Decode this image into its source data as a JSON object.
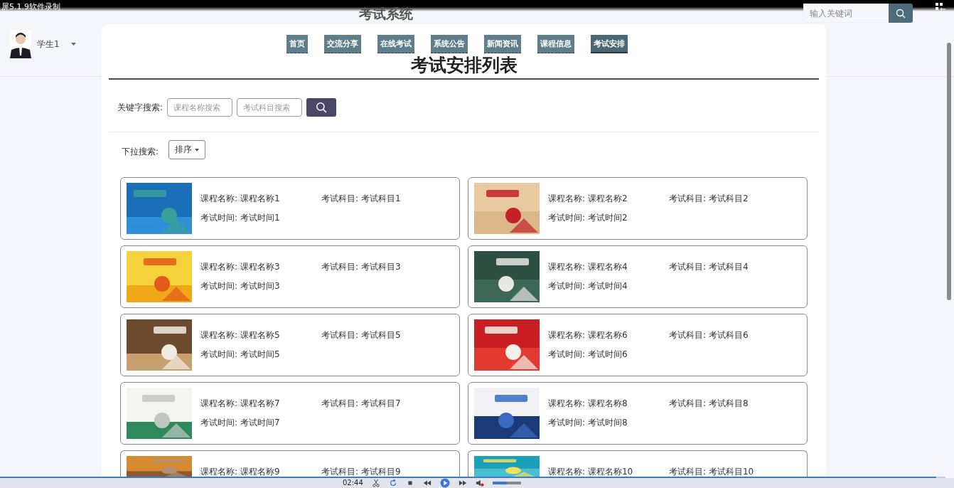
{
  "recorder": {
    "title": "屏5.1.9软件录制",
    "time": "02:44",
    "progress": {
      "level": 0.99
    },
    "volume": {
      "level": 0.5
    }
  },
  "header": {
    "site_title": "考试系统",
    "user": {
      "name": "学生1"
    },
    "search": {
      "placeholder": "输入关键词"
    }
  },
  "nav": [
    {
      "label": "首页",
      "selected": false
    },
    {
      "label": "交流分享",
      "selected": false
    },
    {
      "label": "在线考试",
      "selected": false
    },
    {
      "label": "系统公告",
      "selected": false
    },
    {
      "label": "新闻资讯",
      "selected": false
    },
    {
      "label": "课程信息",
      "selected": false
    },
    {
      "label": "考试安排",
      "selected": true
    }
  ],
  "page_title": "考试安排列表",
  "keyword_search": {
    "label": "关键字搜索:",
    "fields": [
      {
        "placeholder": "课程名称搜索"
      },
      {
        "placeholder": "考试科目搜索"
      }
    ]
  },
  "dropdown_search": {
    "label": "下拉搜索:",
    "button": "排序"
  },
  "cards": [
    {
      "name_label": "课程名称:",
      "name": "课程名称1",
      "subject_label": "考试科目:",
      "subject": "考试科目1",
      "time_label": "考试时间:",
      "time": "考试时间1"
    },
    {
      "name_label": "课程名称:",
      "name": "课程名称2",
      "subject_label": "考试科目:",
      "subject": "考试科目2",
      "time_label": "考试时间:",
      "time": "考试时间2"
    },
    {
      "name_label": "课程名称:",
      "name": "课程名称3",
      "subject_label": "考试科目:",
      "subject": "考试科目3",
      "time_label": "考试时间:",
      "time": "考试时间3"
    },
    {
      "name_label": "课程名称:",
      "name": "课程名称4",
      "subject_label": "考试科目:",
      "subject": "考试科目4",
      "time_label": "考试时间:",
      "time": "考试时间4"
    },
    {
      "name_label": "课程名称:",
      "name": "课程名称5",
      "subject_label": "考试科目:",
      "subject": "考试科目5",
      "time_label": "考试时间:",
      "time": "考试时间5"
    },
    {
      "name_label": "课程名称:",
      "name": "课程名称6",
      "subject_label": "考试科目:",
      "subject": "考试科目6",
      "time_label": "考试时间:",
      "time": "考试时间6"
    },
    {
      "name_label": "课程名称:",
      "name": "课程名称7",
      "subject_label": "考试科目:",
      "subject": "考试科目7",
      "time_label": "考试时间:",
      "time": "考试时间7"
    },
    {
      "name_label": "课程名称:",
      "name": "课程名称8",
      "subject_label": "考试科目:",
      "subject": "考试科目8",
      "time_label": "考试时间:",
      "time": "考试时间8"
    },
    {
      "name_label": "课程名称:",
      "name": "课程名称9",
      "subject_label": "考试科目:",
      "subject": "考试科目9"
    },
    {
      "name_label": "课程名称:",
      "name": "课程名称10",
      "subject_label": "考试科目:",
      "subject": "考试科目10"
    }
  ]
}
